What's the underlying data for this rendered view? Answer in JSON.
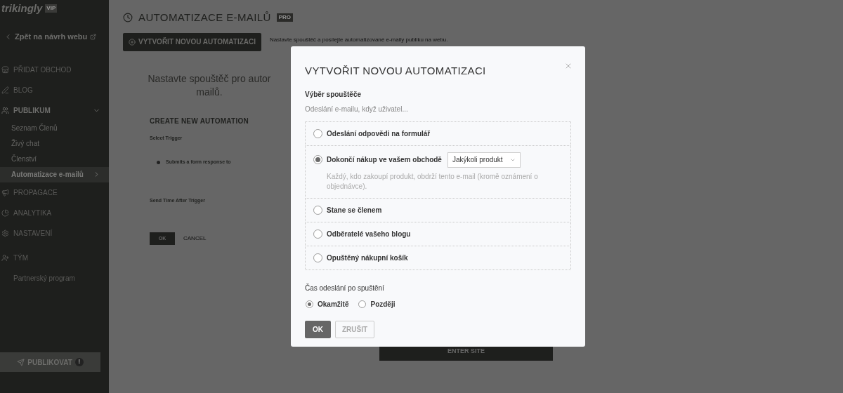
{
  "sidebar": {
    "logo": "trikingly",
    "logo_badge": "VIP",
    "back_link": "Zpět na návrh webu",
    "items": [
      {
        "label": "PŘIDAT OBCHOD"
      },
      {
        "label": "BLOG"
      },
      {
        "label": "PUBLIKUM",
        "expanded": true,
        "children": [
          {
            "label": "Seznam Členů",
            "selected": false
          },
          {
            "label": "Živý chat",
            "selected": false
          },
          {
            "label": "Členství",
            "selected": false
          },
          {
            "label": "Automatizace e-mailů",
            "selected": true
          }
        ]
      },
      {
        "label": "PROPAGACE"
      },
      {
        "label": "ANALYTIKA"
      },
      {
        "label": "NASTAVENÍ"
      },
      {
        "label": "TÝM"
      },
      {
        "label": "Partnerský program"
      }
    ],
    "publish_button": "PUBLIKOVAT",
    "publish_badge": "!"
  },
  "page": {
    "title": "AUTOMATIZACE E-MAILŮ",
    "title_badge": "PRO",
    "create_button": "VYTVOŘIT NOVOU AUTOMATIZACI",
    "description": "Nastavte spouštěč a posílejte automatizované e-maily publiku na webu.",
    "intro_lines": [
      "Nastavte spouštěč pro autor",
      "mailů."
    ],
    "form_title": "CREATE NEW AUTOMATION",
    "trigger_label": "Select Trigger",
    "trigger_option": "Submits a form response to",
    "send_time_label": "Send Time After Trigger",
    "ok_button": "OK",
    "cancel_button": "CANCEL",
    "enter_button": "ENTER SITE"
  },
  "dialog": {
    "title": "VYTVOŘIT NOVOU AUTOMATIZACI",
    "trigger_label": "Výběr spouštěče",
    "trigger_hint": "Odeslání e-mailu, když uživatel...",
    "triggers": [
      {
        "label": "Odeslání odpovědi na formulář",
        "selected": false
      },
      {
        "label": "Dokončí nákup ve vašem obchodě",
        "selected": true,
        "select": "Jakýkoli produkt",
        "note": "Každý, kdo zakoupí produkt, obdrží tento e-mail (kromě oznámení o objednávce)."
      },
      {
        "label": "Stane se členem",
        "selected": false
      },
      {
        "label": "Odběratelé vašeho blogu",
        "selected": false
      },
      {
        "label": "Opuštěný nákupní košík",
        "selected": false
      }
    ],
    "time_label": "Čas odeslání po spuštění",
    "time_options": [
      {
        "label": "Okamžitě",
        "selected": true
      },
      {
        "label": "Později",
        "selected": false
      }
    ],
    "ok_button": "OK",
    "cancel_button": "ZRUŠIT"
  }
}
